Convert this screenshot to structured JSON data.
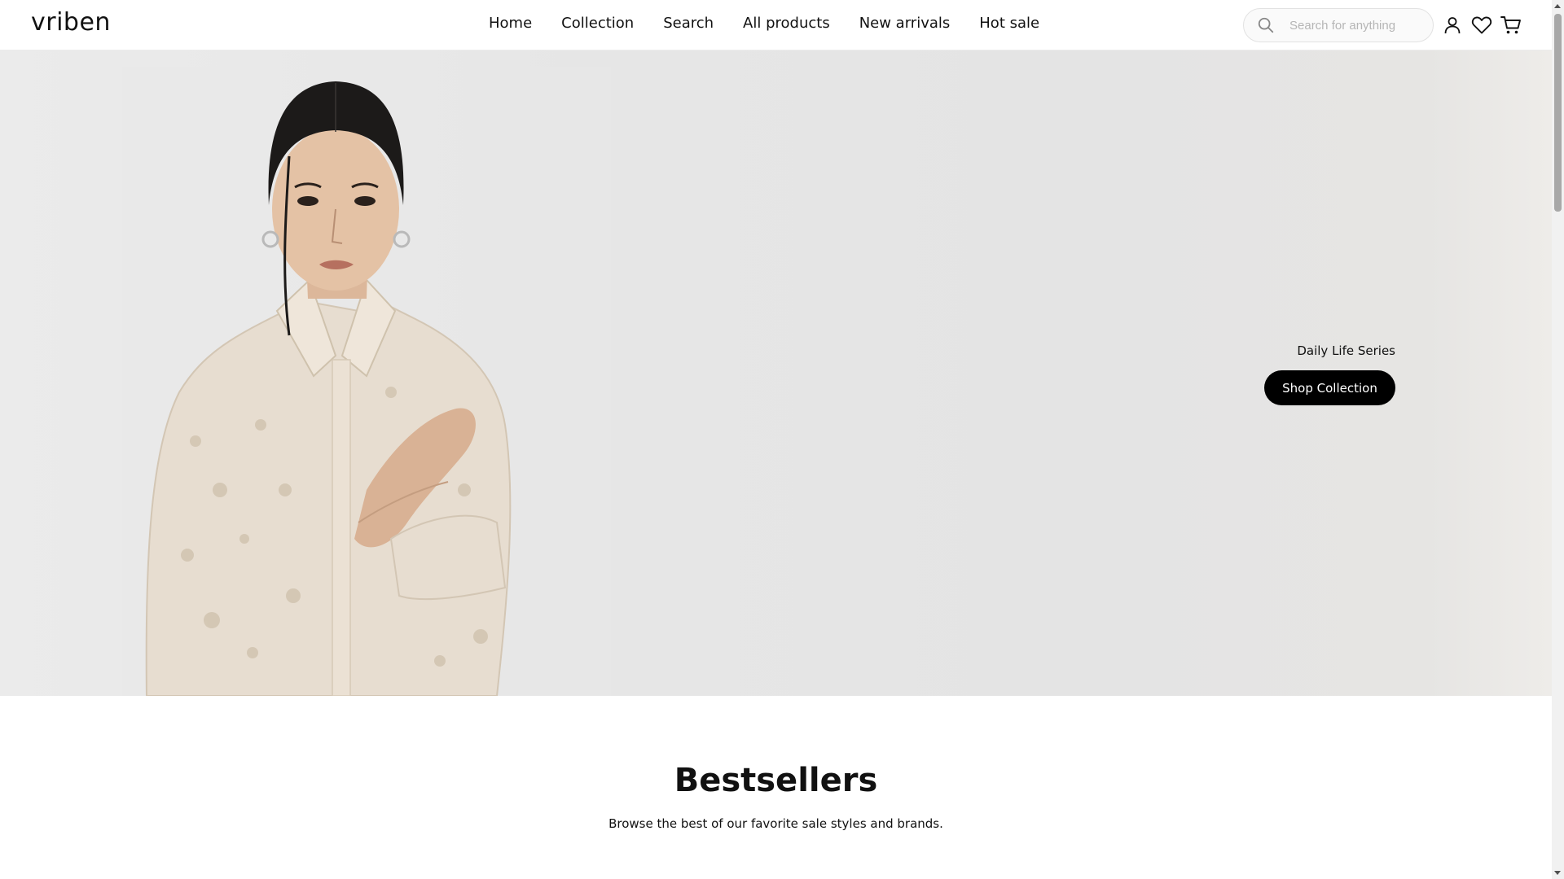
{
  "header": {
    "logo": "vriben",
    "nav": [
      {
        "label": "Home"
      },
      {
        "label": "Collection"
      },
      {
        "label": "Search"
      },
      {
        "label": "All products"
      },
      {
        "label": "New arrivals"
      },
      {
        "label": "Hot sale"
      }
    ],
    "search": {
      "placeholder": "Search for anything",
      "value": ""
    },
    "icons": [
      "search-icon",
      "user-icon",
      "heart-icon",
      "cart-icon"
    ]
  },
  "hero": {
    "caption": "Daily Life Series",
    "cta_label": "Shop Collection"
  },
  "bestsellers": {
    "title": "Bestsellers",
    "subtitle": "Browse the best of our favorite sale styles and brands."
  },
  "colors": {
    "cta_background": "#000000",
    "hero_background": "#e6e6e6",
    "text": "#111111"
  }
}
